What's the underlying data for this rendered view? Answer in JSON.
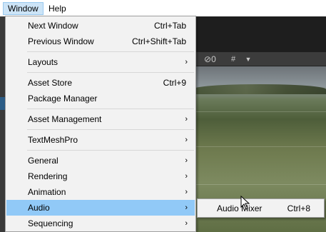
{
  "menubar": {
    "window_label": "Window",
    "help_label": "Help"
  },
  "scene_toolbar": {
    "hidden_count": "0",
    "gizmo_icon": "grid-gizmo-icon",
    "dropdown_icon": "caret-down-icon"
  },
  "menu": {
    "items": [
      {
        "label": "Next Window",
        "shortcut": "Ctrl+Tab"
      },
      {
        "label": "Previous Window",
        "shortcut": "Ctrl+Shift+Tab"
      },
      {
        "label": "Layouts",
        "submenu": "›"
      },
      {
        "label": "Asset Store",
        "shortcut": "Ctrl+9"
      },
      {
        "label": "Package Manager"
      },
      {
        "label": "Asset Management",
        "submenu": "›"
      },
      {
        "label": "TextMeshPro",
        "submenu": "›"
      },
      {
        "label": "General",
        "submenu": "›"
      },
      {
        "label": "Rendering",
        "submenu": "›"
      },
      {
        "label": "Animation",
        "submenu": "›"
      },
      {
        "label": "Audio",
        "submenu": "›"
      },
      {
        "label": "Sequencing",
        "submenu": "›"
      }
    ],
    "active_item": "Audio"
  },
  "submenu": {
    "items": [
      {
        "label": "Audio Mixer",
        "shortcut": "Ctrl+8"
      }
    ]
  },
  "colors": {
    "menu_bg": "#f2f2f2",
    "highlight": "#91c9f7",
    "menubar_active": "#cce4f7"
  }
}
